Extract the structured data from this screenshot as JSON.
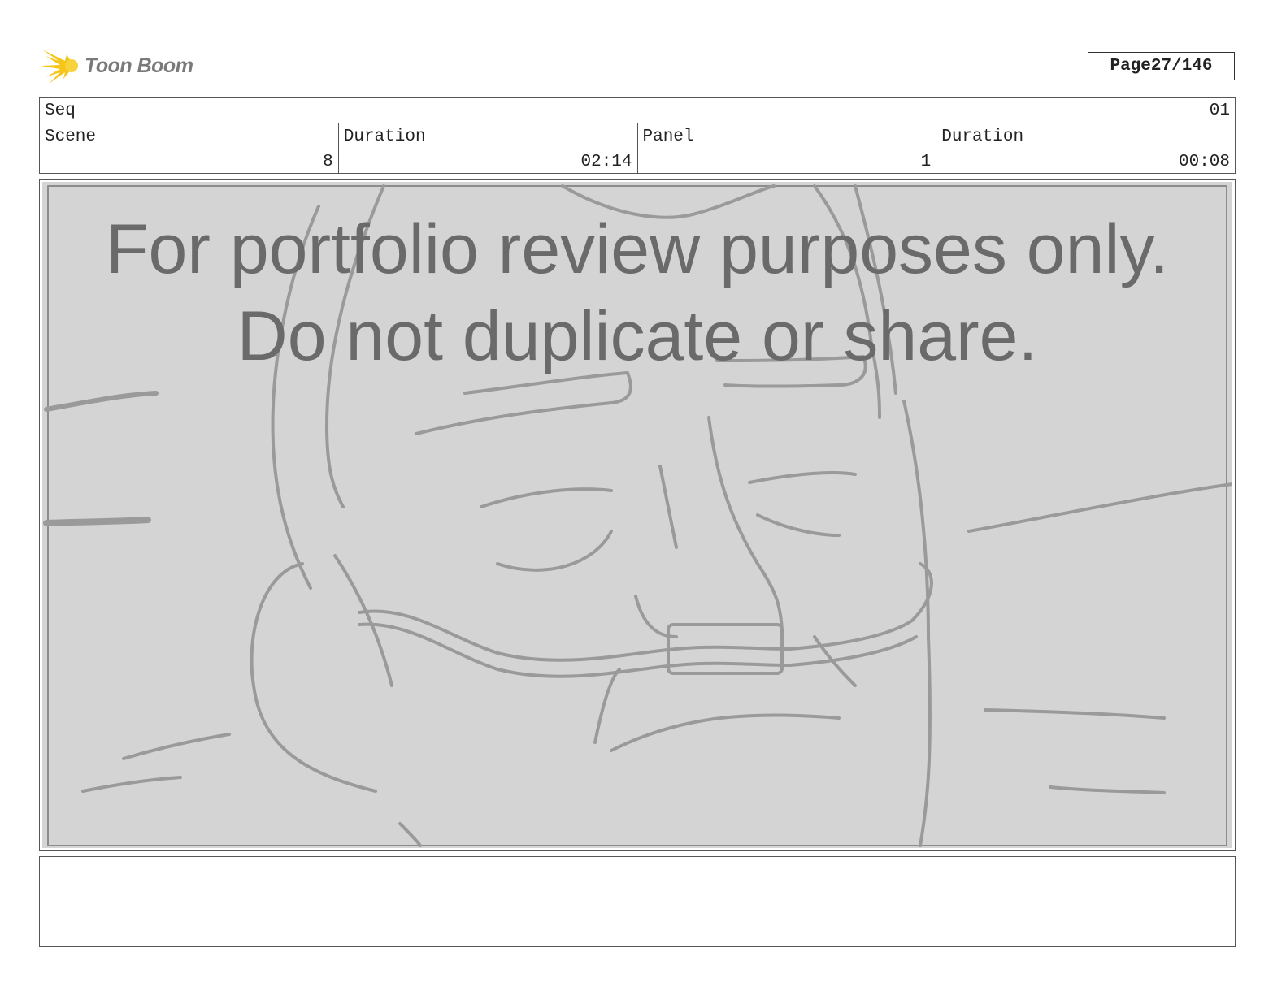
{
  "brand": {
    "name": "Toon Boom",
    "logo_icon": "starburst-icon",
    "accent": "#f5c518"
  },
  "page": {
    "label": "Page",
    "value": "27/146"
  },
  "header": {
    "seq_label": "Seq",
    "seq_value": "01",
    "scene_label": "Scene",
    "scene_value": "8",
    "scene_duration_label": "Duration",
    "scene_duration_value": "02:14",
    "panel_label": "Panel",
    "panel_value": "1",
    "panel_duration_label": "Duration",
    "panel_duration_value": "00:08"
  },
  "panel_image": {
    "watermark_line1": "For portfolio review purposes only.",
    "watermark_line2": "Do not duplicate or share.",
    "background": "#d4d4d4",
    "stroke": "#9a9a9a"
  },
  "notes": {
    "text": ""
  }
}
